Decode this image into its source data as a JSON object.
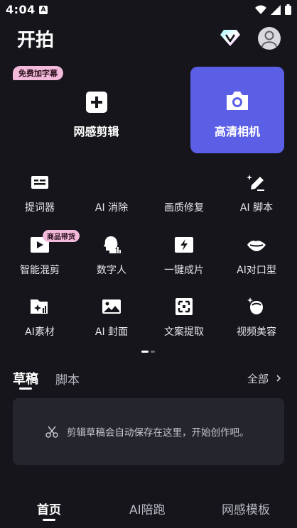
{
  "status_bar": {
    "time": "4:04",
    "app_indicator": "A"
  },
  "header": {
    "title": "开拍"
  },
  "main_actions": {
    "edit": {
      "label": "网感剪辑",
      "badge": "免费加字幕"
    },
    "camera": {
      "label": "高清相机"
    }
  },
  "tools": [
    {
      "label": "提词器",
      "icon": "teleprompter-icon"
    },
    {
      "label": "AI 消除",
      "icon": "none"
    },
    {
      "label": "画质修复",
      "icon": "none"
    },
    {
      "label": "AI 脚本",
      "icon": "ai-pen-icon"
    },
    {
      "label": "智能混剪",
      "icon": "play-icon",
      "badge": "商品带货"
    },
    {
      "label": "数字人",
      "icon": "digital-human-icon"
    },
    {
      "label": "一键成片",
      "icon": "lightning-icon"
    },
    {
      "label": "AI对口型",
      "icon": "lips-icon"
    },
    {
      "label": "AI素材",
      "icon": "ai-folder-icon"
    },
    {
      "label": "AI 封面",
      "icon": "image-icon"
    },
    {
      "label": "文案提取",
      "icon": "scan-icon"
    },
    {
      "label": "视频美容",
      "icon": "beauty-icon"
    }
  ],
  "drafts": {
    "tabs": [
      "草稿",
      "脚本"
    ],
    "all_label": "全部",
    "empty_message": "剪辑草稿会自动保存在这里，开始创作吧。"
  },
  "bottom_nav": {
    "items": [
      "首页",
      "AI陪跑",
      "网感模板"
    ],
    "active_index": 0
  },
  "colors": {
    "background": "#15151b",
    "camera_card": "#5b5fe6",
    "badge": "#f3b9da",
    "card": "#25252d"
  }
}
